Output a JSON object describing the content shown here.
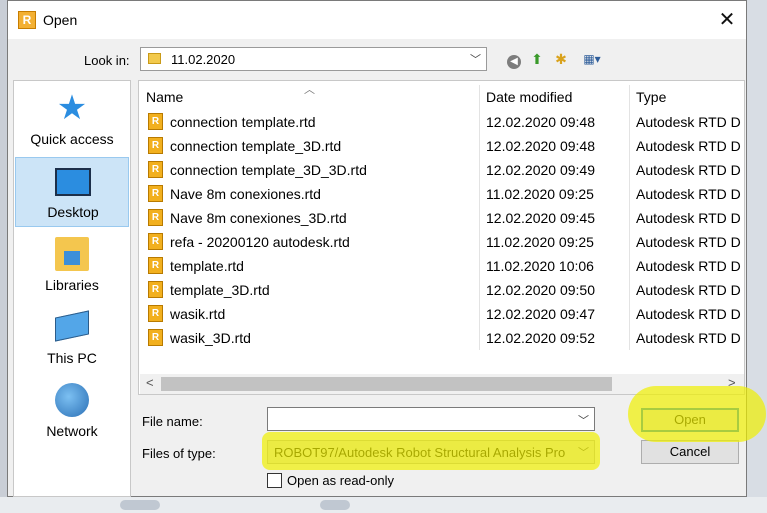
{
  "dialog": {
    "title": "Open",
    "app_icon_letter": "R",
    "close_symbol": "✕"
  },
  "look_in": {
    "label": "Look in:",
    "value": "11.02.2020"
  },
  "toolbar": {
    "icons": [
      "back-icon",
      "up-folder-icon",
      "new-folder-icon",
      "view-menu-icon"
    ]
  },
  "places": [
    {
      "label": "Quick access",
      "icon": "star-icon",
      "selected": false
    },
    {
      "label": "Desktop",
      "icon": "desktop-icon",
      "selected": true
    },
    {
      "label": "Libraries",
      "icon": "libraries-icon",
      "selected": false
    },
    {
      "label": "This PC",
      "icon": "computer-icon",
      "selected": false
    },
    {
      "label": "Network",
      "icon": "network-icon",
      "selected": false
    }
  ],
  "columns": [
    "Name",
    "Date modified",
    "Type"
  ],
  "files": [
    {
      "name": "connection template.rtd",
      "date": "12.02.2020 09:48",
      "type": "Autodesk RTD D"
    },
    {
      "name": "connection template_3D.rtd",
      "date": "12.02.2020 09:48",
      "type": "Autodesk RTD D"
    },
    {
      "name": "connection template_3D_3D.rtd",
      "date": "12.02.2020 09:49",
      "type": "Autodesk RTD D"
    },
    {
      "name": "Nave 8m conexiones.rtd",
      "date": "11.02.2020 09:25",
      "type": "Autodesk RTD D"
    },
    {
      "name": "Nave 8m conexiones_3D.rtd",
      "date": "12.02.2020 09:45",
      "type": "Autodesk RTD D"
    },
    {
      "name": "refa - 20200120 autodesk.rtd",
      "date": "11.02.2020 09:25",
      "type": "Autodesk RTD D"
    },
    {
      "name": "template.rtd",
      "date": "11.02.2020 10:06",
      "type": "Autodesk RTD D"
    },
    {
      "name": "template_3D.rtd",
      "date": "12.02.2020 09:50",
      "type": "Autodesk RTD D"
    },
    {
      "name": "wasik.rtd",
      "date": "12.02.2020 09:47",
      "type": "Autodesk RTD D"
    },
    {
      "name": "wasik_3D.rtd",
      "date": "12.02.2020 09:52",
      "type": "Autodesk RTD D"
    }
  ],
  "form": {
    "file_name_label": "File name:",
    "file_name_value": "",
    "files_of_type_label": "Files of type:",
    "files_of_type_value": "ROBOT97/Autodesk Robot Structural Analysis Pro",
    "open_label": "Open",
    "cancel_label": "Cancel",
    "read_only_label": "Open as read-only",
    "read_only_checked": false
  },
  "colors": {
    "selection": "#cce4f7",
    "highlighter": "#f0f000",
    "primary_border": "#0078d7"
  }
}
